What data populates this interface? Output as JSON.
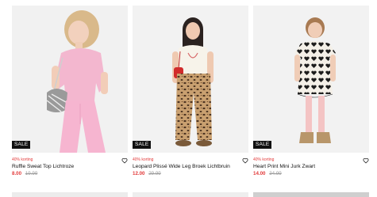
{
  "products": [
    {
      "badge": "SALE",
      "discount": "40% korting",
      "title": "Ruffle Sweat Top Lichtroze",
      "price_new": "8.00",
      "price_old": "19.99"
    },
    {
      "badge": "SALE",
      "discount": "40% korting",
      "title": "Leopard Plissé Wide Leg Broek Lichtbruin",
      "price_new": "12.00",
      "price_old": "29.99"
    },
    {
      "badge": "SALE",
      "discount": "40% korting",
      "title": "Heart Print Mini Jurk Zwart",
      "price_new": "14.00",
      "price_old": "34.99"
    }
  ],
  "icons": {
    "favorite": "heart-outline-icon"
  },
  "colors": {
    "discount": "#e23a3a",
    "badge_bg": "#111111",
    "photo_bg": "#f0f0f0"
  }
}
